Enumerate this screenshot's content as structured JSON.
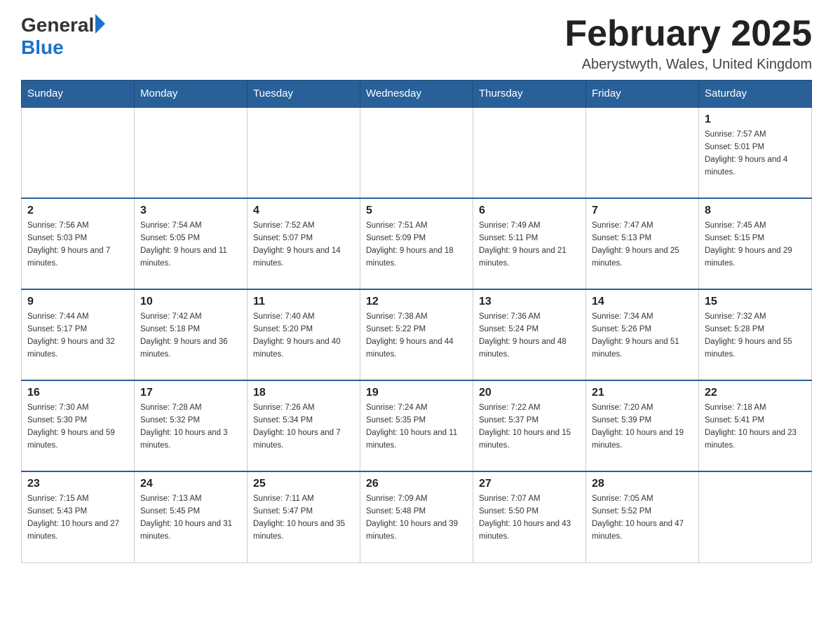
{
  "header": {
    "logo_general": "General",
    "logo_blue": "Blue",
    "month_title": "February 2025",
    "location": "Aberystwyth, Wales, United Kingdom"
  },
  "weekdays": [
    "Sunday",
    "Monday",
    "Tuesday",
    "Wednesday",
    "Thursday",
    "Friday",
    "Saturday"
  ],
  "weeks": [
    [
      {
        "day": "",
        "info": ""
      },
      {
        "day": "",
        "info": ""
      },
      {
        "day": "",
        "info": ""
      },
      {
        "day": "",
        "info": ""
      },
      {
        "day": "",
        "info": ""
      },
      {
        "day": "",
        "info": ""
      },
      {
        "day": "1",
        "info": "Sunrise: 7:57 AM\nSunset: 5:01 PM\nDaylight: 9 hours and 4 minutes."
      }
    ],
    [
      {
        "day": "2",
        "info": "Sunrise: 7:56 AM\nSunset: 5:03 PM\nDaylight: 9 hours and 7 minutes."
      },
      {
        "day": "3",
        "info": "Sunrise: 7:54 AM\nSunset: 5:05 PM\nDaylight: 9 hours and 11 minutes."
      },
      {
        "day": "4",
        "info": "Sunrise: 7:52 AM\nSunset: 5:07 PM\nDaylight: 9 hours and 14 minutes."
      },
      {
        "day": "5",
        "info": "Sunrise: 7:51 AM\nSunset: 5:09 PM\nDaylight: 9 hours and 18 minutes."
      },
      {
        "day": "6",
        "info": "Sunrise: 7:49 AM\nSunset: 5:11 PM\nDaylight: 9 hours and 21 minutes."
      },
      {
        "day": "7",
        "info": "Sunrise: 7:47 AM\nSunset: 5:13 PM\nDaylight: 9 hours and 25 minutes."
      },
      {
        "day": "8",
        "info": "Sunrise: 7:45 AM\nSunset: 5:15 PM\nDaylight: 9 hours and 29 minutes."
      }
    ],
    [
      {
        "day": "9",
        "info": "Sunrise: 7:44 AM\nSunset: 5:17 PM\nDaylight: 9 hours and 32 minutes."
      },
      {
        "day": "10",
        "info": "Sunrise: 7:42 AM\nSunset: 5:18 PM\nDaylight: 9 hours and 36 minutes."
      },
      {
        "day": "11",
        "info": "Sunrise: 7:40 AM\nSunset: 5:20 PM\nDaylight: 9 hours and 40 minutes."
      },
      {
        "day": "12",
        "info": "Sunrise: 7:38 AM\nSunset: 5:22 PM\nDaylight: 9 hours and 44 minutes."
      },
      {
        "day": "13",
        "info": "Sunrise: 7:36 AM\nSunset: 5:24 PM\nDaylight: 9 hours and 48 minutes."
      },
      {
        "day": "14",
        "info": "Sunrise: 7:34 AM\nSunset: 5:26 PM\nDaylight: 9 hours and 51 minutes."
      },
      {
        "day": "15",
        "info": "Sunrise: 7:32 AM\nSunset: 5:28 PM\nDaylight: 9 hours and 55 minutes."
      }
    ],
    [
      {
        "day": "16",
        "info": "Sunrise: 7:30 AM\nSunset: 5:30 PM\nDaylight: 9 hours and 59 minutes."
      },
      {
        "day": "17",
        "info": "Sunrise: 7:28 AM\nSunset: 5:32 PM\nDaylight: 10 hours and 3 minutes."
      },
      {
        "day": "18",
        "info": "Sunrise: 7:26 AM\nSunset: 5:34 PM\nDaylight: 10 hours and 7 minutes."
      },
      {
        "day": "19",
        "info": "Sunrise: 7:24 AM\nSunset: 5:35 PM\nDaylight: 10 hours and 11 minutes."
      },
      {
        "day": "20",
        "info": "Sunrise: 7:22 AM\nSunset: 5:37 PM\nDaylight: 10 hours and 15 minutes."
      },
      {
        "day": "21",
        "info": "Sunrise: 7:20 AM\nSunset: 5:39 PM\nDaylight: 10 hours and 19 minutes."
      },
      {
        "day": "22",
        "info": "Sunrise: 7:18 AM\nSunset: 5:41 PM\nDaylight: 10 hours and 23 minutes."
      }
    ],
    [
      {
        "day": "23",
        "info": "Sunrise: 7:15 AM\nSunset: 5:43 PM\nDaylight: 10 hours and 27 minutes."
      },
      {
        "day": "24",
        "info": "Sunrise: 7:13 AM\nSunset: 5:45 PM\nDaylight: 10 hours and 31 minutes."
      },
      {
        "day": "25",
        "info": "Sunrise: 7:11 AM\nSunset: 5:47 PM\nDaylight: 10 hours and 35 minutes."
      },
      {
        "day": "26",
        "info": "Sunrise: 7:09 AM\nSunset: 5:48 PM\nDaylight: 10 hours and 39 minutes."
      },
      {
        "day": "27",
        "info": "Sunrise: 7:07 AM\nSunset: 5:50 PM\nDaylight: 10 hours and 43 minutes."
      },
      {
        "day": "28",
        "info": "Sunrise: 7:05 AM\nSunset: 5:52 PM\nDaylight: 10 hours and 47 minutes."
      },
      {
        "day": "",
        "info": ""
      }
    ]
  ]
}
